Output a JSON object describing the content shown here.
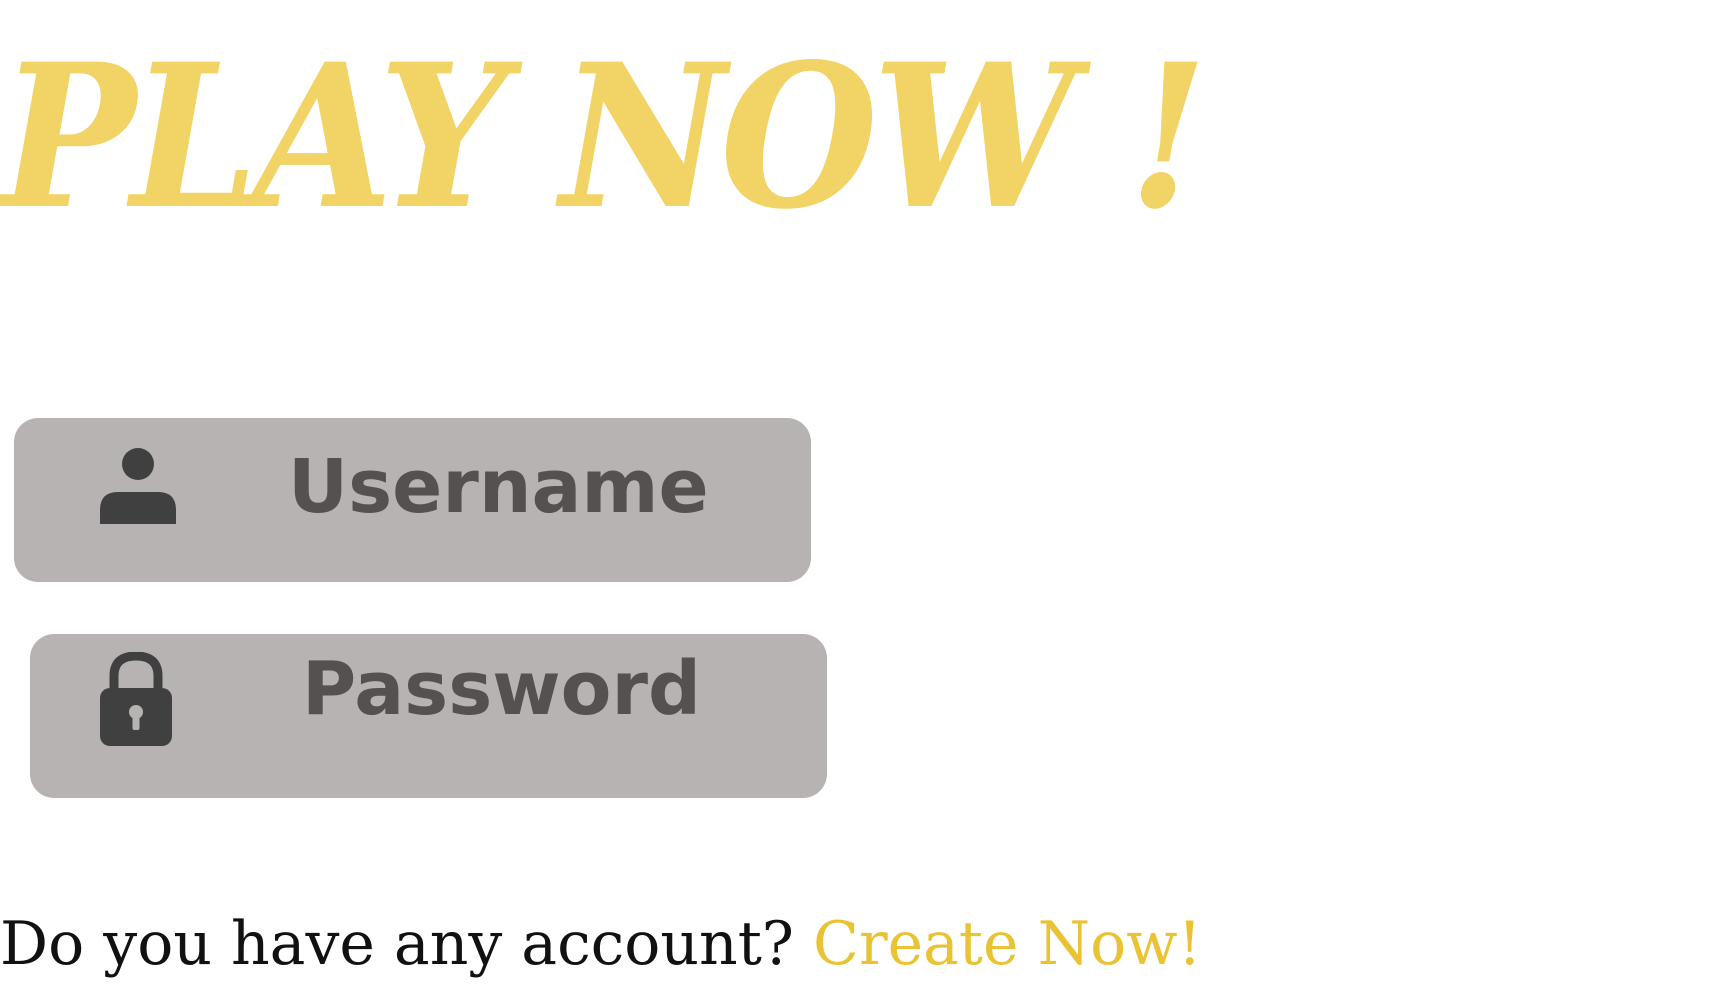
{
  "title": "PLAY NOW !",
  "username": {
    "placeholder": "Username",
    "icon": "user-icon"
  },
  "password": {
    "placeholder": "Password",
    "icon": "lock-icon"
  },
  "footer": {
    "prompt": "Do you have any account? ",
    "link": "Create Now!"
  },
  "colors": {
    "title": "#f1d366",
    "field_background": "#b7b3b2",
    "field_text": "#555151",
    "link": "#eac335",
    "text": "#111111"
  }
}
